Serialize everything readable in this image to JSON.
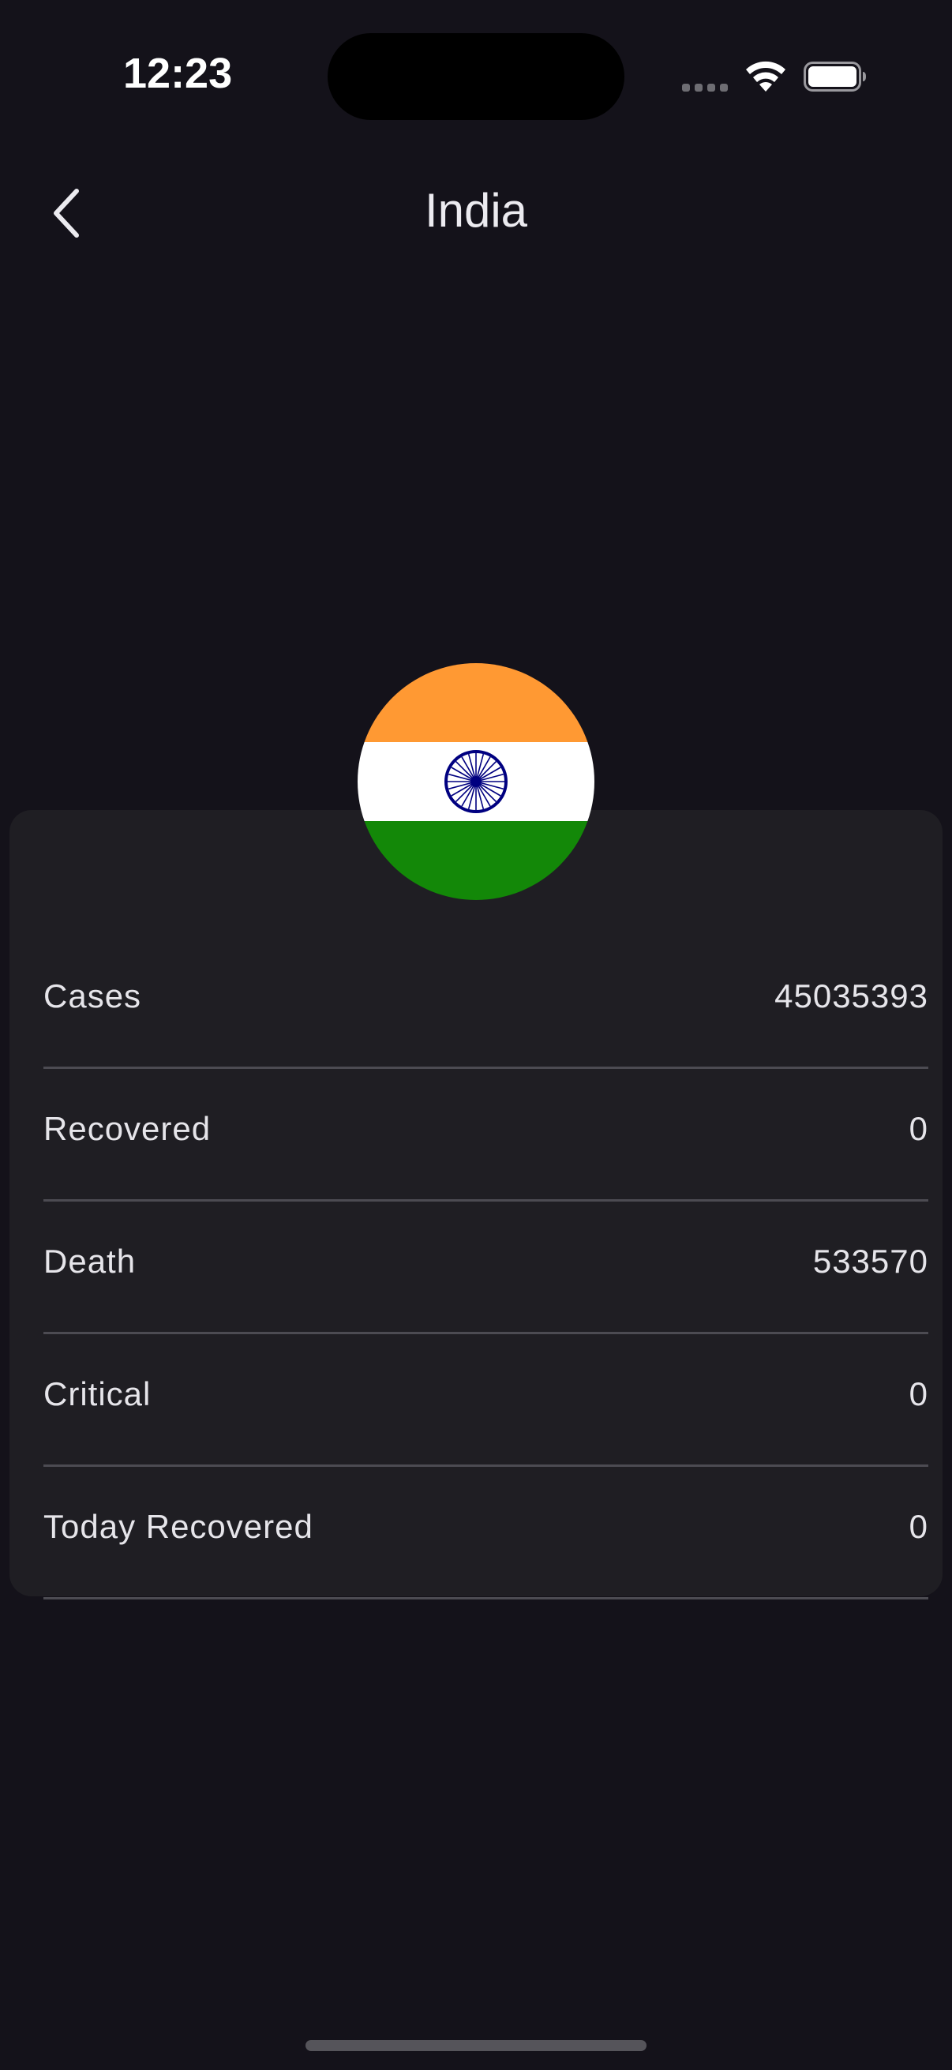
{
  "status_bar": {
    "time": "12:23",
    "icons": [
      "signal-dots-icon",
      "wifi-icon",
      "battery-icon"
    ]
  },
  "nav": {
    "back_icon": "chevron-left-icon",
    "title": "India"
  },
  "country": {
    "flag_icon": "india-flag-icon",
    "colors": {
      "saffron": "#FF9933",
      "white": "#FFFFFF",
      "green": "#138808",
      "chakra": "#000080"
    }
  },
  "stats": [
    {
      "label": "Cases",
      "value": "45035393"
    },
    {
      "label": "Recovered",
      "value": "0"
    },
    {
      "label": "Death",
      "value": "533570"
    },
    {
      "label": "Critical",
      "value": "0"
    },
    {
      "label": "Today Recovered",
      "value": "0"
    }
  ],
  "theme": {
    "background": "#14121A",
    "card": "#1F1E23",
    "divider": "#4C4B52",
    "text": "#ECEBF0"
  }
}
